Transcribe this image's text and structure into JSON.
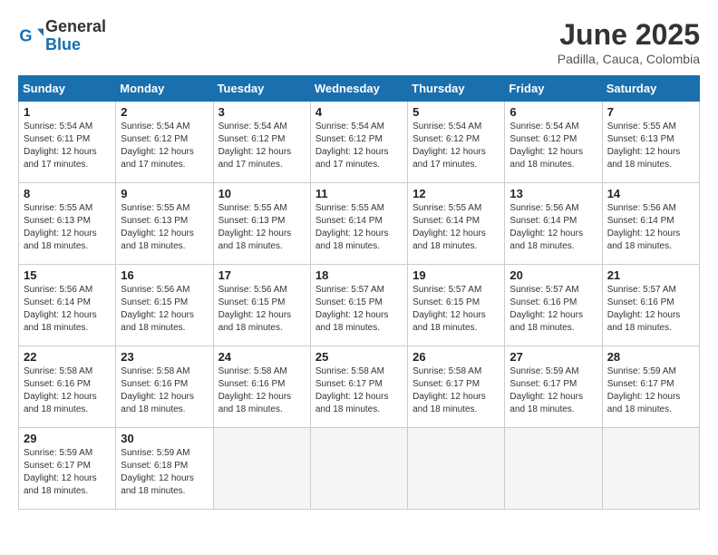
{
  "logo": {
    "general": "General",
    "blue": "Blue"
  },
  "title": "June 2025",
  "subtitle": "Padilla, Cauca, Colombia",
  "days_of_week": [
    "Sunday",
    "Monday",
    "Tuesday",
    "Wednesday",
    "Thursday",
    "Friday",
    "Saturday"
  ],
  "weeks": [
    [
      {
        "day": "1",
        "sunrise": "5:54 AM",
        "sunset": "6:11 PM",
        "daylight": "12 hours and 17 minutes."
      },
      {
        "day": "2",
        "sunrise": "5:54 AM",
        "sunset": "6:12 PM",
        "daylight": "12 hours and 17 minutes."
      },
      {
        "day": "3",
        "sunrise": "5:54 AM",
        "sunset": "6:12 PM",
        "daylight": "12 hours and 17 minutes."
      },
      {
        "day": "4",
        "sunrise": "5:54 AM",
        "sunset": "6:12 PM",
        "daylight": "12 hours and 17 minutes."
      },
      {
        "day": "5",
        "sunrise": "5:54 AM",
        "sunset": "6:12 PM",
        "daylight": "12 hours and 17 minutes."
      },
      {
        "day": "6",
        "sunrise": "5:54 AM",
        "sunset": "6:12 PM",
        "daylight": "12 hours and 18 minutes."
      },
      {
        "day": "7",
        "sunrise": "5:55 AM",
        "sunset": "6:13 PM",
        "daylight": "12 hours and 18 minutes."
      }
    ],
    [
      {
        "day": "8",
        "sunrise": "5:55 AM",
        "sunset": "6:13 PM",
        "daylight": "12 hours and 18 minutes."
      },
      {
        "day": "9",
        "sunrise": "5:55 AM",
        "sunset": "6:13 PM",
        "daylight": "12 hours and 18 minutes."
      },
      {
        "day": "10",
        "sunrise": "5:55 AM",
        "sunset": "6:13 PM",
        "daylight": "12 hours and 18 minutes."
      },
      {
        "day": "11",
        "sunrise": "5:55 AM",
        "sunset": "6:14 PM",
        "daylight": "12 hours and 18 minutes."
      },
      {
        "day": "12",
        "sunrise": "5:55 AM",
        "sunset": "6:14 PM",
        "daylight": "12 hours and 18 minutes."
      },
      {
        "day": "13",
        "sunrise": "5:56 AM",
        "sunset": "6:14 PM",
        "daylight": "12 hours and 18 minutes."
      },
      {
        "day": "14",
        "sunrise": "5:56 AM",
        "sunset": "6:14 PM",
        "daylight": "12 hours and 18 minutes."
      }
    ],
    [
      {
        "day": "15",
        "sunrise": "5:56 AM",
        "sunset": "6:14 PM",
        "daylight": "12 hours and 18 minutes."
      },
      {
        "day": "16",
        "sunrise": "5:56 AM",
        "sunset": "6:15 PM",
        "daylight": "12 hours and 18 minutes."
      },
      {
        "day": "17",
        "sunrise": "5:56 AM",
        "sunset": "6:15 PM",
        "daylight": "12 hours and 18 minutes."
      },
      {
        "day": "18",
        "sunrise": "5:57 AM",
        "sunset": "6:15 PM",
        "daylight": "12 hours and 18 minutes."
      },
      {
        "day": "19",
        "sunrise": "5:57 AM",
        "sunset": "6:15 PM",
        "daylight": "12 hours and 18 minutes."
      },
      {
        "day": "20",
        "sunrise": "5:57 AM",
        "sunset": "6:16 PM",
        "daylight": "12 hours and 18 minutes."
      },
      {
        "day": "21",
        "sunrise": "5:57 AM",
        "sunset": "6:16 PM",
        "daylight": "12 hours and 18 minutes."
      }
    ],
    [
      {
        "day": "22",
        "sunrise": "5:58 AM",
        "sunset": "6:16 PM",
        "daylight": "12 hours and 18 minutes."
      },
      {
        "day": "23",
        "sunrise": "5:58 AM",
        "sunset": "6:16 PM",
        "daylight": "12 hours and 18 minutes."
      },
      {
        "day": "24",
        "sunrise": "5:58 AM",
        "sunset": "6:16 PM",
        "daylight": "12 hours and 18 minutes."
      },
      {
        "day": "25",
        "sunrise": "5:58 AM",
        "sunset": "6:17 PM",
        "daylight": "12 hours and 18 minutes."
      },
      {
        "day": "26",
        "sunrise": "5:58 AM",
        "sunset": "6:17 PM",
        "daylight": "12 hours and 18 minutes."
      },
      {
        "day": "27",
        "sunrise": "5:59 AM",
        "sunset": "6:17 PM",
        "daylight": "12 hours and 18 minutes."
      },
      {
        "day": "28",
        "sunrise": "5:59 AM",
        "sunset": "6:17 PM",
        "daylight": "12 hours and 18 minutes."
      }
    ],
    [
      {
        "day": "29",
        "sunrise": "5:59 AM",
        "sunset": "6:17 PM",
        "daylight": "12 hours and 18 minutes."
      },
      {
        "day": "30",
        "sunrise": "5:59 AM",
        "sunset": "6:18 PM",
        "daylight": "12 hours and 18 minutes."
      },
      null,
      null,
      null,
      null,
      null
    ]
  ]
}
